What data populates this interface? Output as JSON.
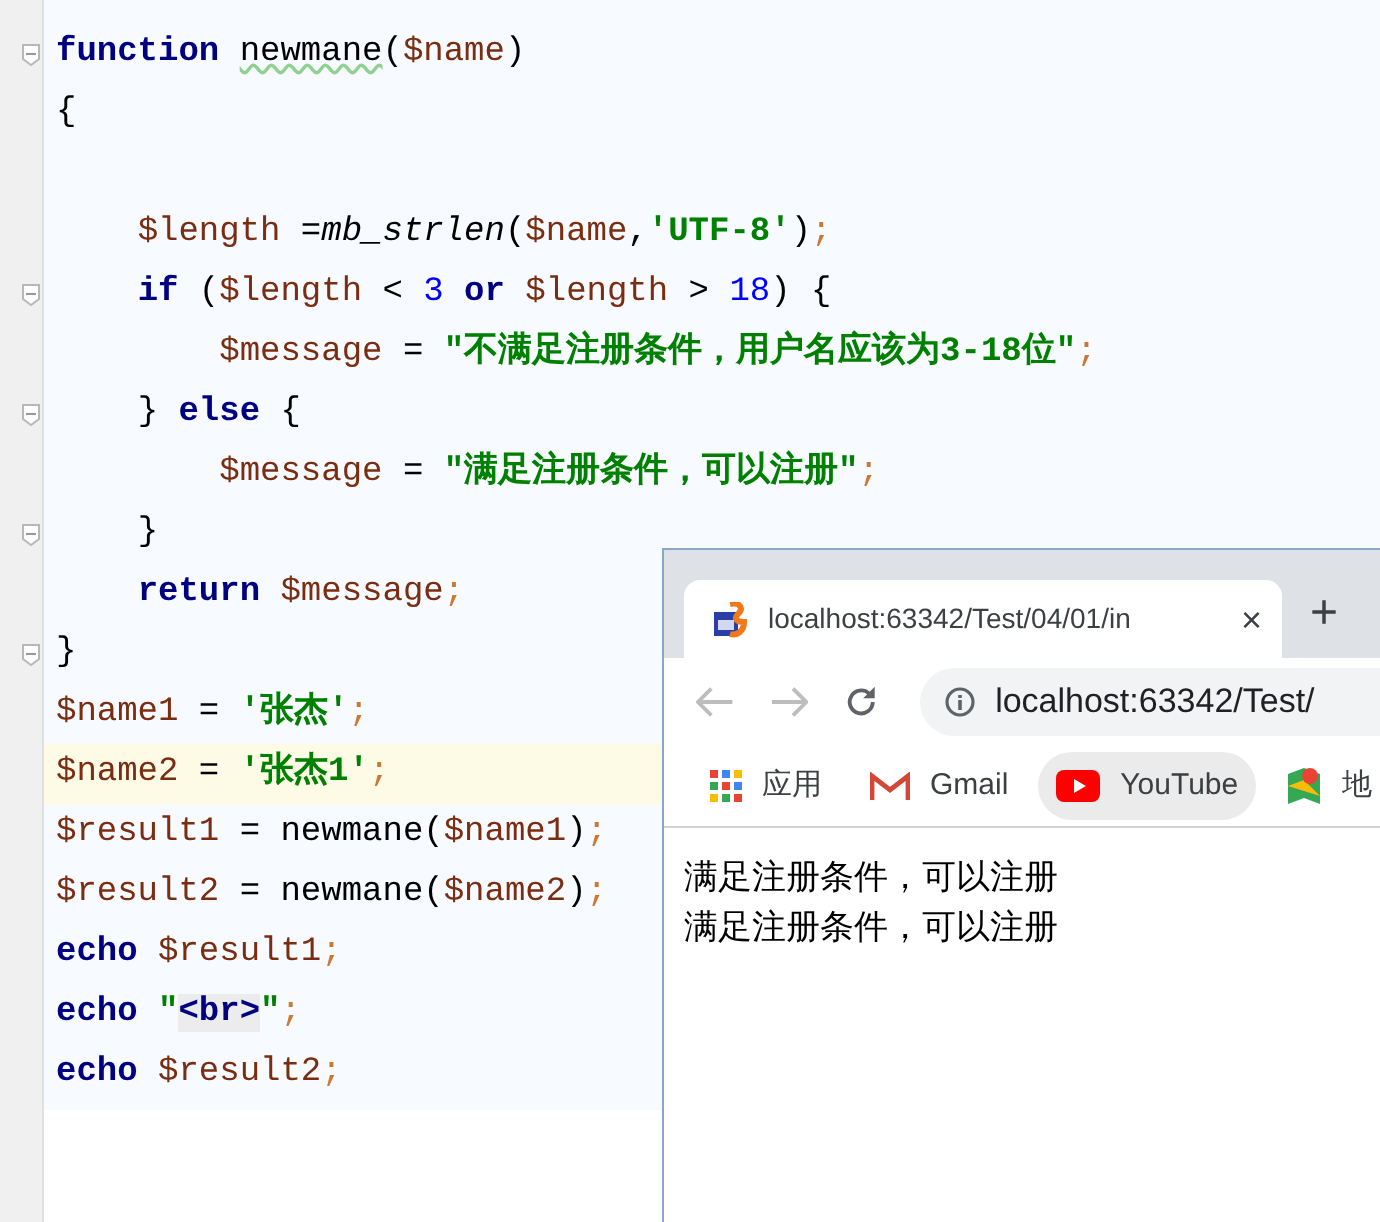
{
  "editor": {
    "lines": [
      {
        "fold": true,
        "current": false,
        "tokens": [
          {
            "kind": "keyword",
            "text": "function "
          },
          {
            "kind": "warn",
            "text": "newmane"
          },
          {
            "kind": "plain",
            "text": "("
          },
          {
            "kind": "variable",
            "text": "$name"
          },
          {
            "kind": "plain",
            "text": ")"
          }
        ]
      },
      {
        "fold": false,
        "current": false,
        "tokens": [
          {
            "kind": "plain",
            "text": "{"
          }
        ]
      },
      {
        "fold": false,
        "current": false
      },
      {
        "fold": false,
        "current": false,
        "tokens": [
          {
            "kind": "variable",
            "text": "    $length"
          },
          {
            "kind": "plain",
            "text": " ="
          },
          {
            "kind": "call",
            "text": "mb_strlen"
          },
          {
            "kind": "plain",
            "text": "("
          },
          {
            "kind": "variable",
            "text": "$name"
          },
          {
            "kind": "plain",
            "text": ","
          },
          {
            "kind": "string",
            "text": "'UTF-8'"
          },
          {
            "kind": "plain",
            "text": ")"
          },
          {
            "kind": "punct",
            "text": ";"
          }
        ]
      },
      {
        "fold": true,
        "current": false,
        "tokens": [
          {
            "kind": "keyword",
            "text": "    if"
          },
          {
            "kind": "plain",
            "text": " ("
          },
          {
            "kind": "variable",
            "text": "$length"
          },
          {
            "kind": "plain",
            "text": " < "
          },
          {
            "kind": "number",
            "text": "3"
          },
          {
            "kind": "keyword",
            "text": " or "
          },
          {
            "kind": "variable",
            "text": "$length"
          },
          {
            "kind": "plain",
            "text": " > "
          },
          {
            "kind": "number",
            "text": "18"
          },
          {
            "kind": "plain",
            "text": ") {"
          }
        ]
      },
      {
        "fold": false,
        "current": false,
        "tokens": [
          {
            "kind": "variable",
            "text": "        $message"
          },
          {
            "kind": "plain",
            "text": " = "
          },
          {
            "kind": "string",
            "text": "\"不满足注册条件，用户名应该为3-18位\""
          },
          {
            "kind": "punct",
            "text": ";"
          }
        ]
      },
      {
        "fold": true,
        "current": false,
        "tokens": [
          {
            "kind": "plain",
            "text": "    } "
          },
          {
            "kind": "keyword",
            "text": "else"
          },
          {
            "kind": "plain",
            "text": " {"
          }
        ]
      },
      {
        "fold": false,
        "current": false,
        "tokens": [
          {
            "kind": "variable",
            "text": "        $message"
          },
          {
            "kind": "plain",
            "text": " = "
          },
          {
            "kind": "string",
            "text": "\"满足注册条件，可以注册\""
          },
          {
            "kind": "punct",
            "text": ";"
          }
        ]
      },
      {
        "fold": true,
        "current": false,
        "tokens": [
          {
            "kind": "plain",
            "text": "    }"
          }
        ]
      },
      {
        "fold": false,
        "current": false,
        "tokens": [
          {
            "kind": "keyword",
            "text": "    return "
          },
          {
            "kind": "variable",
            "text": "$message"
          },
          {
            "kind": "punct",
            "text": ";"
          }
        ]
      },
      {
        "fold": true,
        "current": false,
        "tokens": [
          {
            "kind": "plain",
            "text": "}"
          }
        ]
      },
      {
        "fold": false,
        "current": false,
        "tokens": [
          {
            "kind": "variable",
            "text": "$name1"
          },
          {
            "kind": "plain",
            "text": " = "
          },
          {
            "kind": "string",
            "text": "'张杰'"
          },
          {
            "kind": "punct",
            "text": ";"
          }
        ]
      },
      {
        "fold": false,
        "current": true,
        "tokens": [
          {
            "kind": "variable",
            "text": "$name2"
          },
          {
            "kind": "plain",
            "text": " = "
          },
          {
            "kind": "string",
            "text": "'张杰1'"
          },
          {
            "kind": "punct",
            "text": ";"
          }
        ]
      },
      {
        "fold": false,
        "current": false,
        "tokens": [
          {
            "kind": "variable",
            "text": "$result1"
          },
          {
            "kind": "plain",
            "text": " = newmane("
          },
          {
            "kind": "variable",
            "text": "$name1"
          },
          {
            "kind": "plain",
            "text": ")"
          },
          {
            "kind": "punct",
            "text": ";"
          }
        ]
      },
      {
        "fold": false,
        "current": false,
        "tokens": [
          {
            "kind": "variable",
            "text": "$result2"
          },
          {
            "kind": "plain",
            "text": " = newmane("
          },
          {
            "kind": "variable",
            "text": "$name2"
          },
          {
            "kind": "plain",
            "text": ")"
          },
          {
            "kind": "punct",
            "text": ";"
          }
        ]
      },
      {
        "fold": false,
        "current": false,
        "tokens": [
          {
            "kind": "keyword",
            "text": "echo "
          },
          {
            "kind": "variable",
            "text": "$result1"
          },
          {
            "kind": "punct",
            "text": ";"
          }
        ]
      },
      {
        "fold": false,
        "current": false,
        "tokens": [
          {
            "kind": "keyword",
            "text": "echo "
          },
          {
            "kind": "string",
            "text": "\""
          },
          {
            "kind": "tag",
            "text": "<br>"
          },
          {
            "kind": "string",
            "text": "\""
          },
          {
            "kind": "punct",
            "text": ";"
          }
        ]
      },
      {
        "fold": false,
        "current": false,
        "tokens": [
          {
            "kind": "keyword",
            "text": "echo "
          },
          {
            "kind": "variable",
            "text": "$result2"
          },
          {
            "kind": "punct",
            "text": ";"
          }
        ]
      }
    ]
  },
  "browser": {
    "tab": {
      "title": "localhost:63342/Test/04/01/in",
      "close": "×"
    },
    "new_tab": "+",
    "address": "localhost:63342/Test/",
    "back_disabled": true,
    "bookmarks": [
      {
        "kind": "apps",
        "label": "应用",
        "highlighted": false
      },
      {
        "kind": "gmail",
        "label": "Gmail",
        "highlighted": false
      },
      {
        "kind": "youtube",
        "label": "YouTube",
        "highlighted": true
      },
      {
        "kind": "maps",
        "label": "地",
        "highlighted": false
      }
    ],
    "content": [
      "满足注册条件，可以注册",
      "满足注册条件，可以注册"
    ]
  }
}
